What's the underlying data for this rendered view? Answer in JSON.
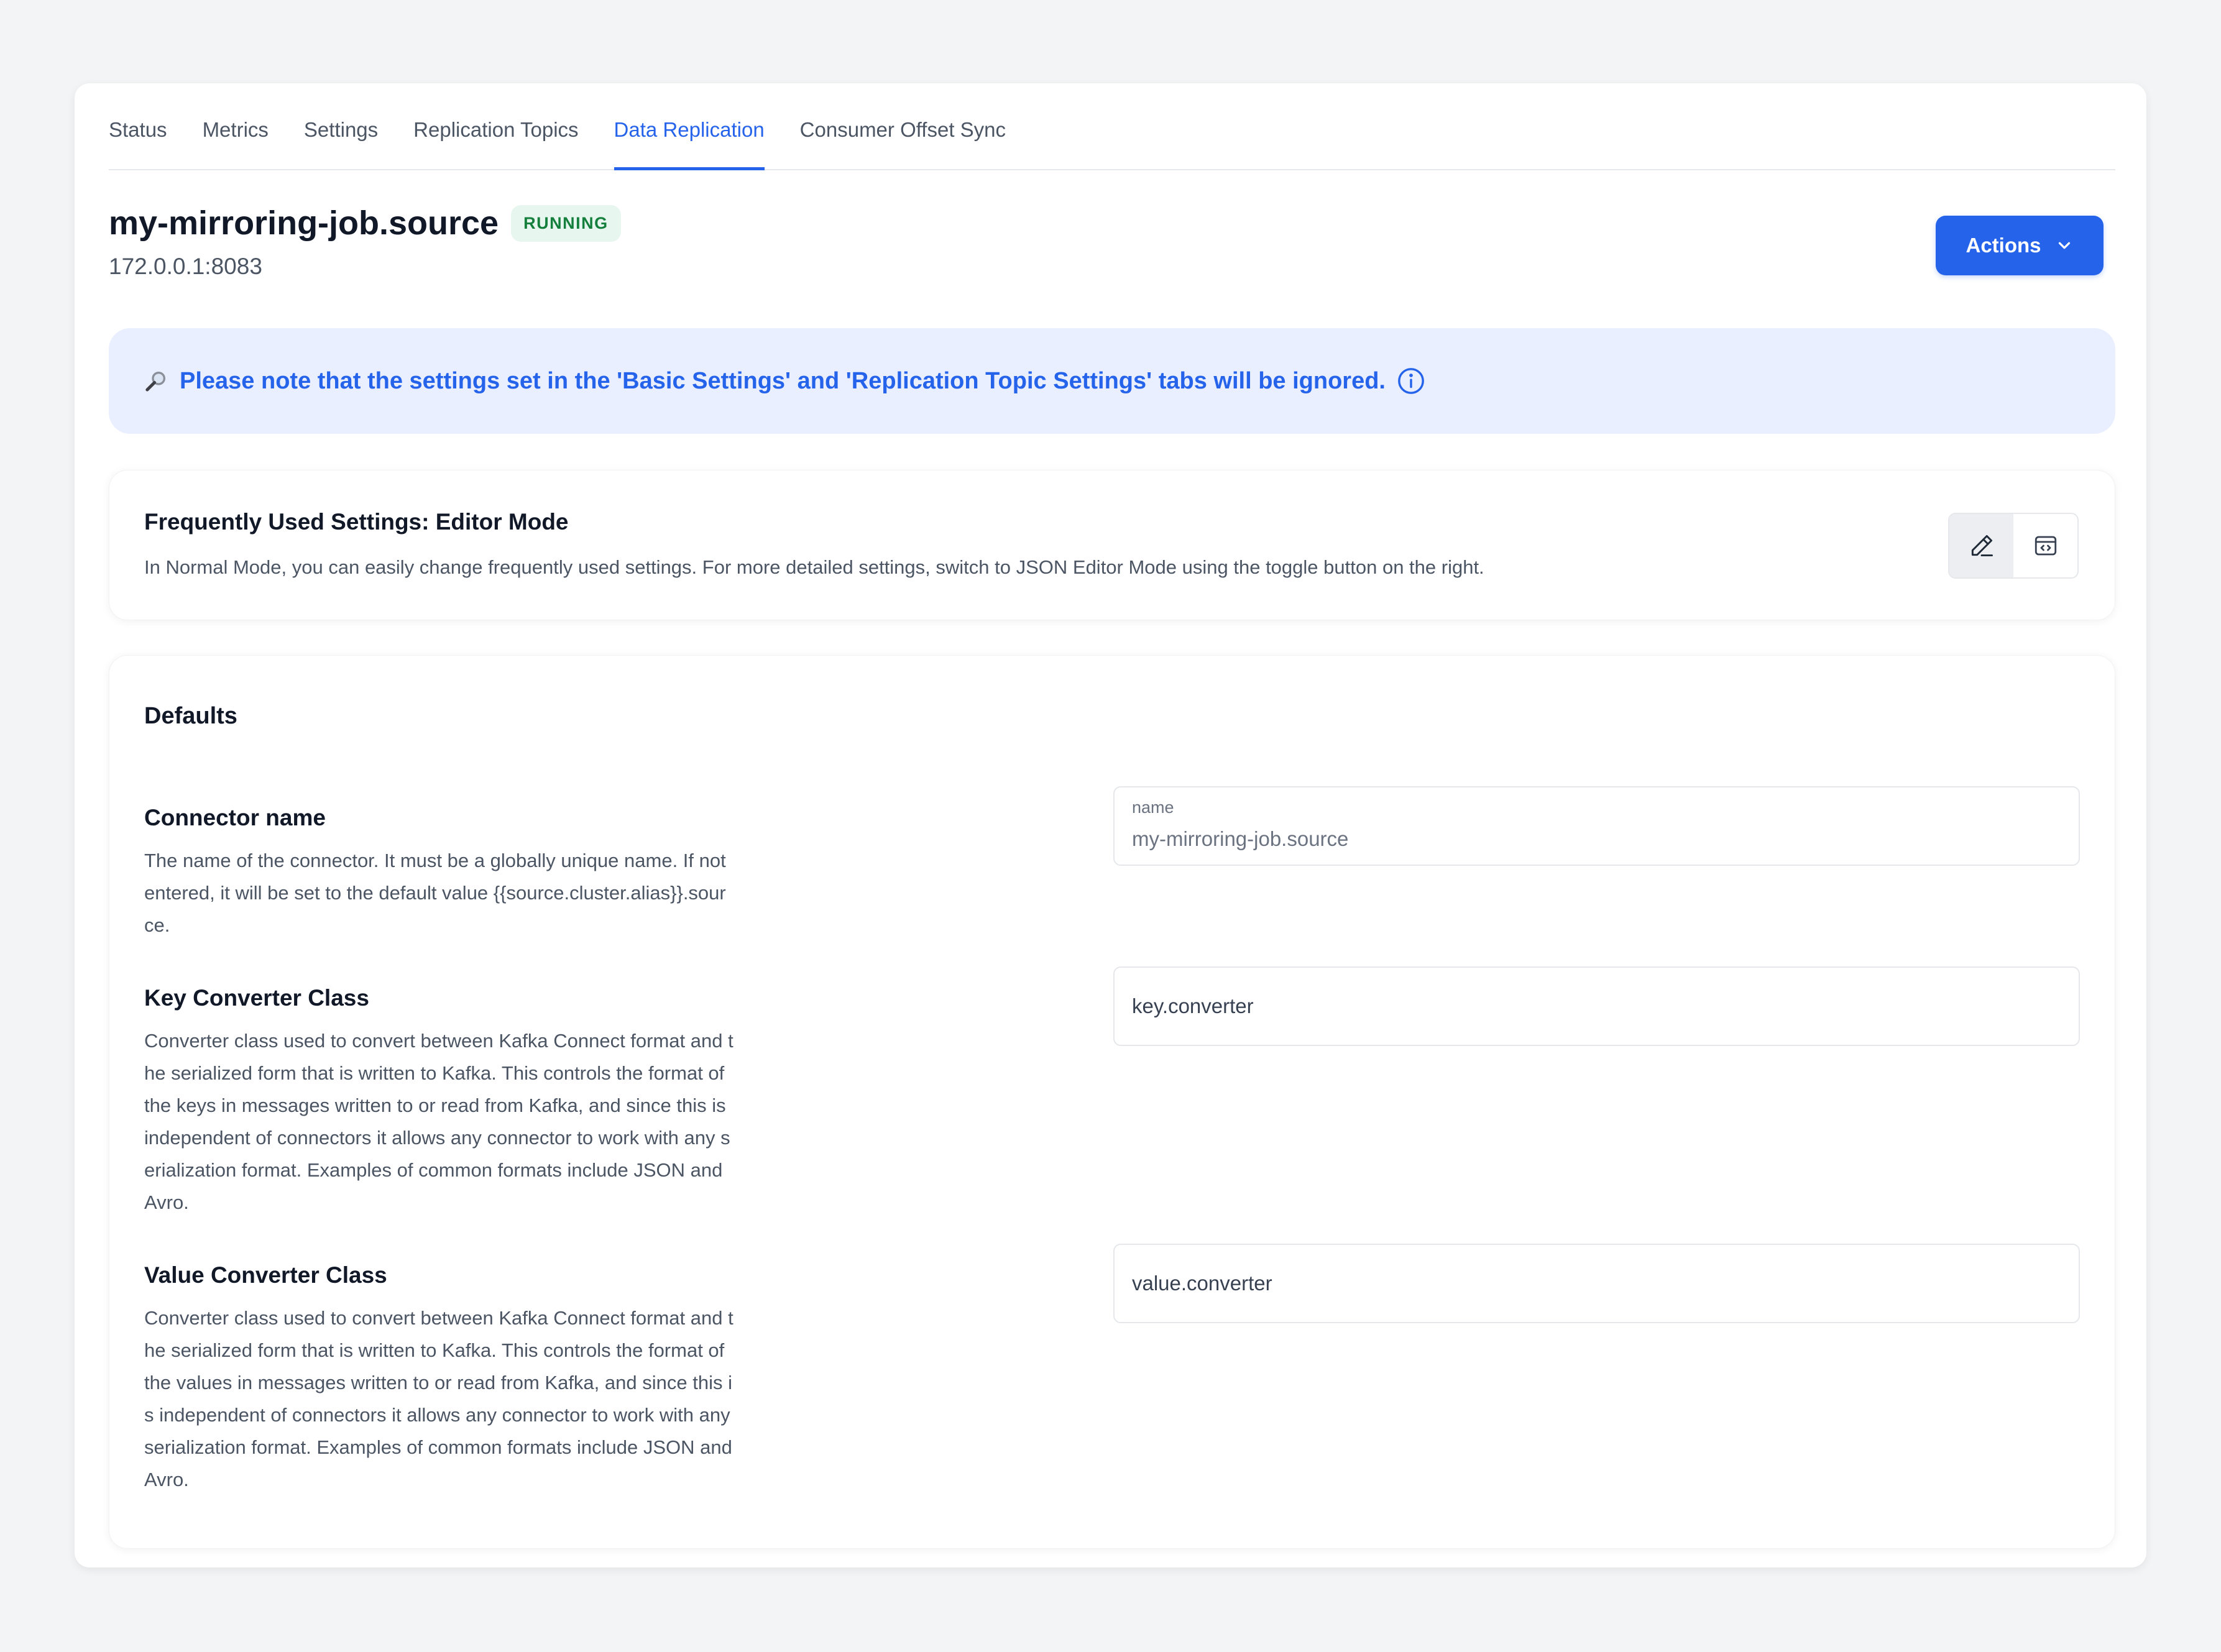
{
  "tabs": [
    {
      "label": "Status",
      "active": false
    },
    {
      "label": "Metrics",
      "active": false
    },
    {
      "label": "Settings",
      "active": false
    },
    {
      "label": "Replication Topics",
      "active": false
    },
    {
      "label": "Data Replication",
      "active": true
    },
    {
      "label": "Consumer Offset Sync",
      "active": false
    }
  ],
  "header": {
    "title": "my-mirroring-job.source",
    "status_badge": "RUNNING",
    "address": "172.0.0.1:8083",
    "actions_label": "Actions"
  },
  "notice": {
    "icon": "magnifier-icon",
    "text": "Please note that the settings set in the 'Basic Settings' and 'Replication Topic Settings' tabs will be ignored."
  },
  "editor_mode": {
    "title": "Frequently Used Settings: Editor Mode",
    "description": "In Normal Mode, you can easily change frequently used settings. For more detailed settings, switch to JSON Editor Mode using the toggle button on the right.",
    "active_mode": "normal"
  },
  "defaults": {
    "title": "Defaults",
    "fields": [
      {
        "label": "Connector name",
        "description": "The name of the connector. It must be a globally unique name. If not entered, it will be set to the default value {{source.cluster.alias}}.source.",
        "input_label": "name",
        "input_value": "my-mirroring-job.source"
      },
      {
        "label": "Key Converter Class",
        "description": "Converter class used to convert between Kafka Connect format and the serialized form that is written to Kafka. This controls the format of the keys in messages written to or read from Kafka, and since this is independent of connectors it allows any connector to work with any serialization format. Examples of common formats include JSON and Avro.",
        "input_placeholder": "key.converter"
      },
      {
        "label": "Value Converter Class",
        "description": "Converter class used to convert between Kafka Connect format and the serialized form that is written to Kafka. This controls the format of the values in messages written to or read from Kafka, and since this is independent of connectors it allows any connector to work with any serialization format. Examples of common formats include JSON and Avro.",
        "input_placeholder": "value.converter"
      }
    ]
  },
  "colors": {
    "accent": "#2563eb",
    "badge_bg": "#e7f6ee",
    "badge_text": "#15803d",
    "notice_bg": "#eaefff"
  }
}
